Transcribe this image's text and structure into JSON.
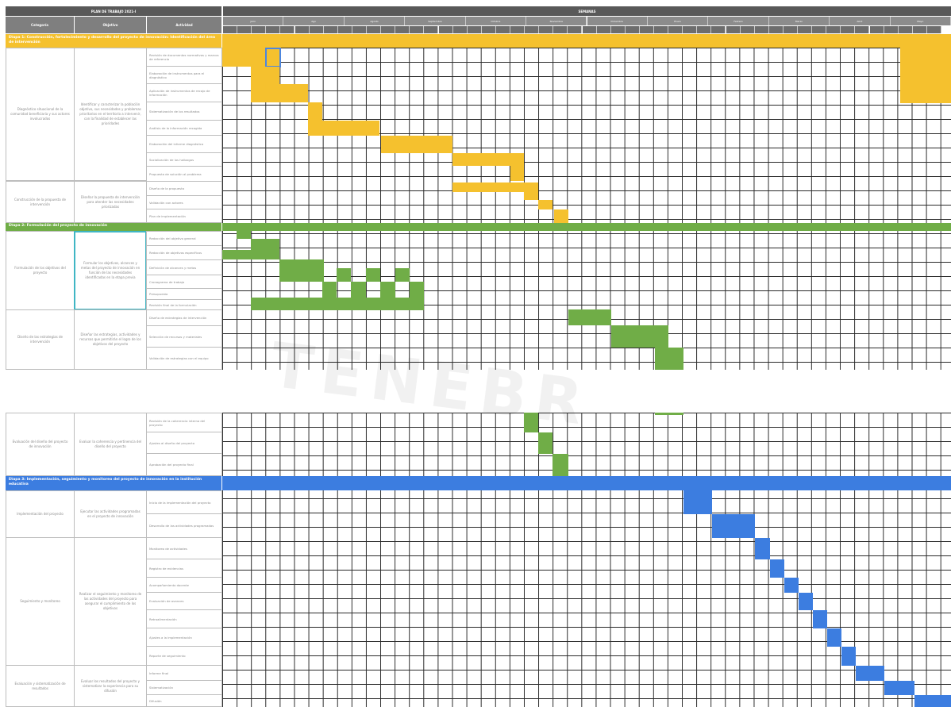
{
  "header": {
    "plan_title": "PLAN DE TRABAJO 2021-I",
    "weeks_title": "SEMANAS",
    "col_stage": "Categoría",
    "col_objective": "Objetivo",
    "col_activity": "Actividad",
    "months": [
      "Julio",
      "Ago",
      "Agosto",
      "Septiembre",
      "Octubre",
      "Noviembre",
      "Diciembre",
      "Enero",
      "Febrero",
      "Marzo",
      "Abril",
      "Mayo"
    ]
  },
  "stages": [
    {
      "label": "Etapa 1: Construcción, fortalecimiento y desarrollo del proyecto de innovación: Identificación del área de intervención",
      "color": "#f5c12e",
      "groups": [
        {
          "title": "Diagnóstico situacional de la comunidad beneficiaria y sus actores involucrados",
          "objective": "Identificar y caracterizar la población objetivo, sus necesidades y problemas prioritarios en el territorio a intervenir, con la finalidad de establecer las prioridades",
          "activities": [
            "Revisión de documentos normativos y marcos de referencia",
            "Elaboración de instrumentos para el diagnóstico",
            "Aplicación de instrumentos de recojo de información",
            "Sistematización de los resultados",
            "Análisis de la información recogida",
            "Elaboración del informe diagnóstico",
            "Socialización de los hallazgos",
            "Propuesta de solución al problema"
          ]
        },
        {
          "title": "Construcción de la propuesta de intervención",
          "objective": "Diseñar la propuesta de intervención para atender las necesidades priorizadas",
          "activities": [
            "Diseño de la propuesta",
            "Validación con actores",
            "Plan de implementación"
          ]
        }
      ]
    },
    {
      "label": "Etapa 2: Formulación del proyecto de innovación",
      "color": "#70ad47",
      "groups": [
        {
          "title": "Formulación de los objetivos del proyecto",
          "objective": "Formular los objetivos, alcances y metas del proyecto de innovación en función de las necesidades identificadas en la etapa previa",
          "activities": [
            "Redacción del objetivo general",
            "Redacción de objetivos específicos",
            "Definición de alcances y metas",
            "Cronograma de trabajo",
            "Presupuesto",
            "Revisión final de la formulación"
          ]
        },
        {
          "title": "Diseño de las estrategias de intervención",
          "objective": "Diseñar las estrategias, actividades y recursos que permitirán el logro de los objetivos del proyecto",
          "activities": [
            "Diseño de estrategias de intervención",
            "Selección de recursos y materiales",
            "Validación de estrategias con el equipo"
          ]
        }
      ]
    },
    {
      "label": "",
      "color": "#70ad47",
      "groups": [
        {
          "title": "Evaluación del diseño del proyecto de innovación",
          "objective": "Evaluar la coherencia y pertinencia del diseño del proyecto",
          "activities": [
            "Revisión de la coherencia interna del proyecto",
            "Ajustes al diseño del proyecto",
            "Aprobación del proyecto final"
          ]
        }
      ]
    },
    {
      "label": "Etapa 3: Implementación, seguimiento y monitoreo del proyecto de innovación en la institución educativa",
      "color": "#3c7de0",
      "groups": [
        {
          "title": "Implementación del proyecto",
          "objective": "Ejecutar las actividades programadas en el proyecto de innovación",
          "activities": [
            "Inicio de la implementación del proyecto",
            "Desarrollo de las actividades programadas"
          ]
        },
        {
          "title": "Seguimiento y monitoreo",
          "objective": "Realizar el seguimiento y monitoreo de las actividades del proyecto para asegurar el cumplimiento de los objetivos",
          "activities": [
            "Monitoreo de actividades",
            "Registro de evidencias",
            "Acompañamiento docente",
            "Evaluación de avances",
            "Retroalimentación",
            "Ajustes a la implementación",
            "Reporte de seguimiento"
          ]
        },
        {
          "title": "Evaluación y sistematización de resultados",
          "objective": "Evaluar los resultados del proyecto y sistematizar la experiencia para su difusión",
          "activities": [
            "Informe final",
            "Sistematización",
            "Difusión"
          ]
        }
      ]
    }
  ]
}
